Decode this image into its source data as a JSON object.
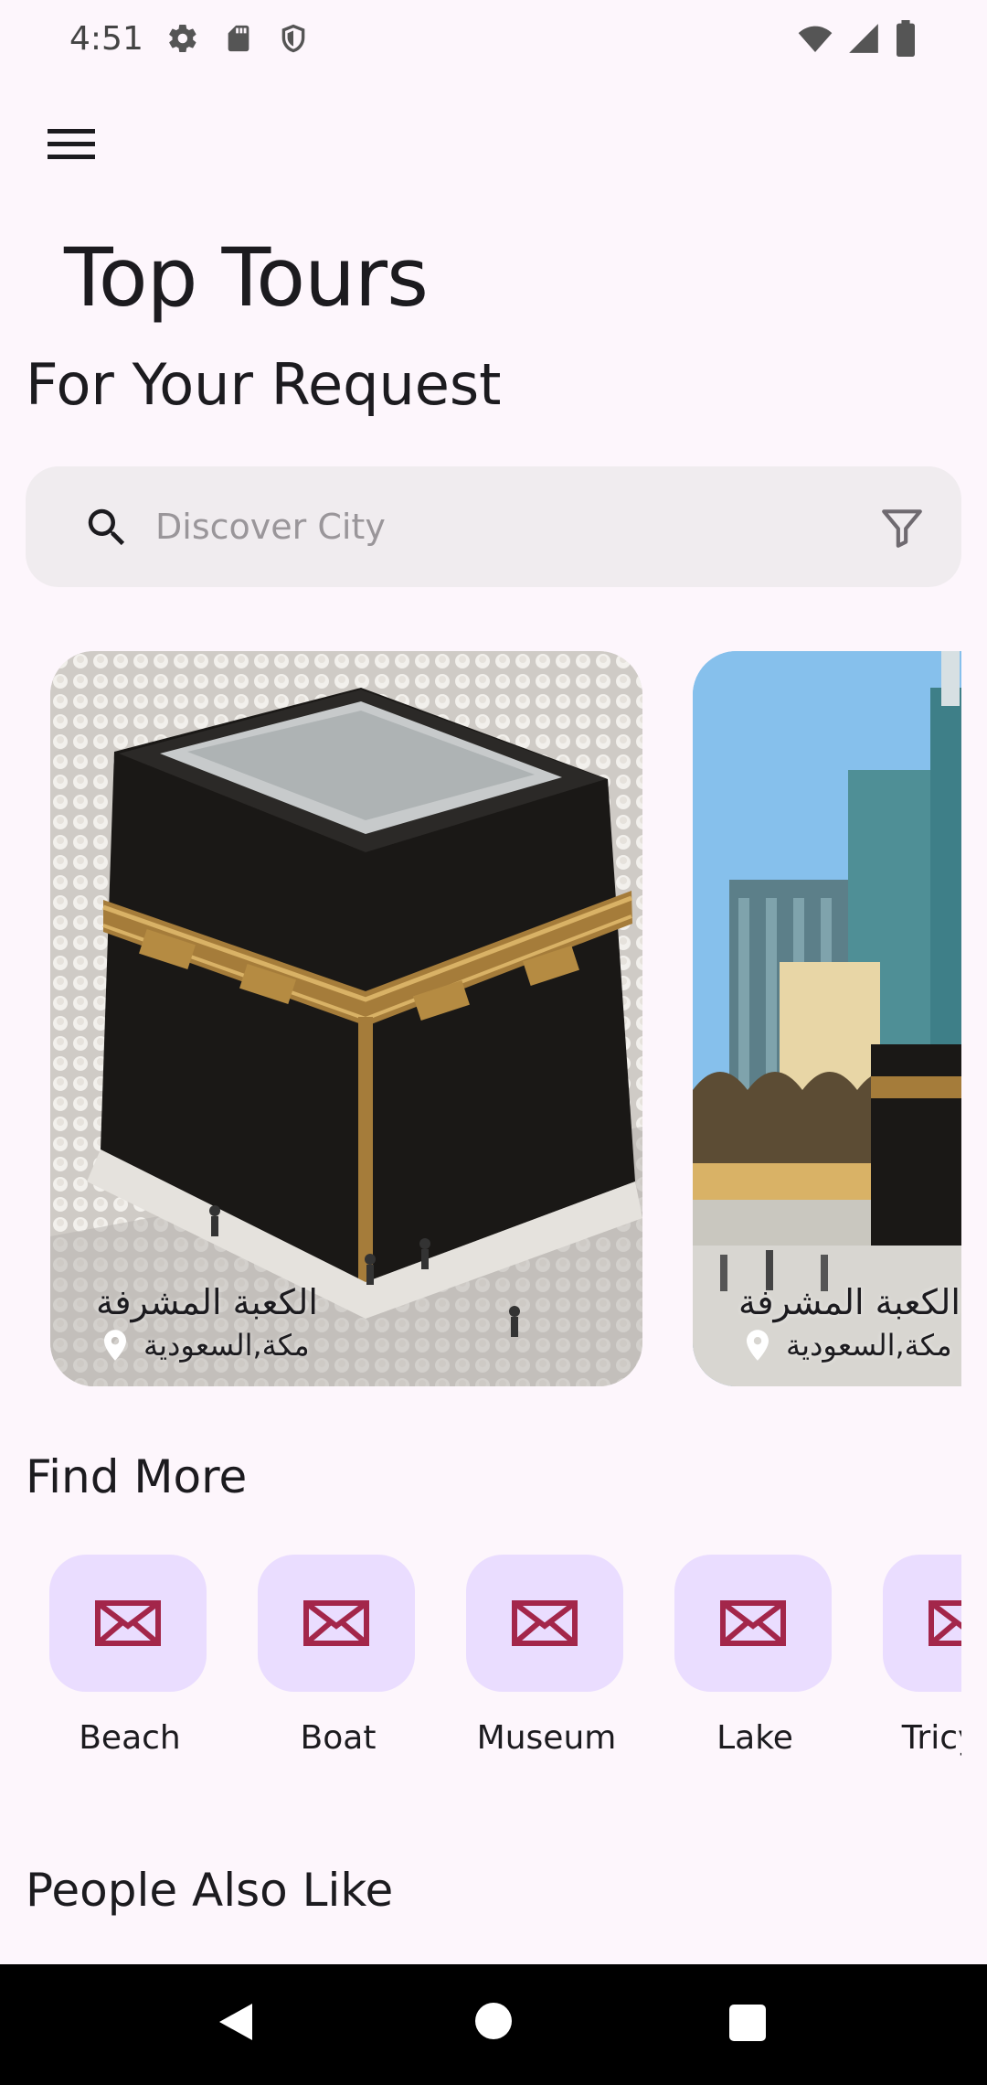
{
  "status_bar": {
    "time": "4:51",
    "left_icons": [
      "settings-icon",
      "sd-card-icon",
      "shield-icon"
    ],
    "right_icons": [
      "wifi-icon",
      "signal-icon",
      "battery-icon"
    ]
  },
  "app_bar": {
    "menu_icon": "menu-icon"
  },
  "header": {
    "title": "Top Tours",
    "subtitle": "For Your Request"
  },
  "search": {
    "placeholder": "Discover City",
    "value": "",
    "search_icon": "search-icon",
    "filter_icon": "filter-icon"
  },
  "tours": [
    {
      "name": "الكعبة المشرفة",
      "location": "مكة,السعودية"
    },
    {
      "name": "الكعبة المشرفة",
      "location": "مكة,السعودية"
    }
  ],
  "find_more": {
    "title": "Find More",
    "categories": [
      {
        "label": "Beach",
        "icon": "broken-image-icon"
      },
      {
        "label": "Boat",
        "icon": "broken-image-icon"
      },
      {
        "label": "Museum",
        "icon": "broken-image-icon"
      },
      {
        "label": "Lake",
        "icon": "broken-image-icon"
      },
      {
        "label": "Tricycle",
        "icon": "broken-image-icon"
      }
    ]
  },
  "people_also_like": {
    "title": "People Also Like"
  },
  "colors": {
    "background": "#FDF6FC",
    "search_bg": "#F0ECEF",
    "category_tile": "#EADDFF",
    "category_icon": "#A3264A",
    "nav_bar": "#000000"
  },
  "nav_bar": {
    "buttons": [
      "back-icon",
      "home-icon",
      "recents-icon"
    ]
  }
}
